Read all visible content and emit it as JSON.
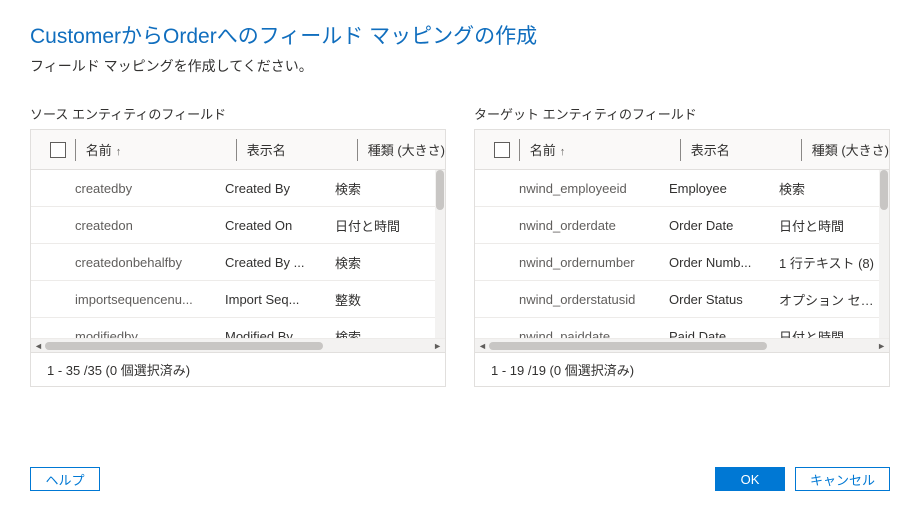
{
  "title": "CustomerからOrderへのフィールド マッピングの作成",
  "subtitle": "フィールド マッピングを作成してください。",
  "source": {
    "label": "ソース エンティティのフィールド",
    "columns": {
      "name": "名前",
      "display": "表示名",
      "type": "種類 (大きさ)"
    },
    "rows": [
      {
        "name": "createdby",
        "display": "Created By",
        "type": "検索"
      },
      {
        "name": "createdon",
        "display": "Created On",
        "type": "日付と時間"
      },
      {
        "name": "createdonbehalfby",
        "display": "Created By ...",
        "type": "検索"
      },
      {
        "name": "importsequencenu...",
        "display": "Import Seq...",
        "type": "整数"
      },
      {
        "name": "modifiedby",
        "display": "Modified By",
        "type": "検索"
      }
    ],
    "footer": "1 - 35 /35 (0 個選択済み)"
  },
  "target": {
    "label": "ターゲット エンティティのフィールド",
    "columns": {
      "name": "名前",
      "display": "表示名",
      "type": "種類 (大きさ)"
    },
    "rows": [
      {
        "name": "nwind_employeeid",
        "display": "Employee",
        "type": "検索"
      },
      {
        "name": "nwind_orderdate",
        "display": "Order Date",
        "type": "日付と時間"
      },
      {
        "name": "nwind_ordernumber",
        "display": "Order Numb...",
        "type": "1 行テキスト (8)"
      },
      {
        "name": "nwind_orderstatusid",
        "display": "Order Status",
        "type": "オプション セット"
      },
      {
        "name": "nwind_paiddate",
        "display": "Paid Date",
        "type": "日付と時間"
      }
    ],
    "footer": "1 - 19 /19 (0 個選択済み)"
  },
  "buttons": {
    "help": "ヘルプ",
    "ok": "OK",
    "cancel": "キャンセル"
  }
}
